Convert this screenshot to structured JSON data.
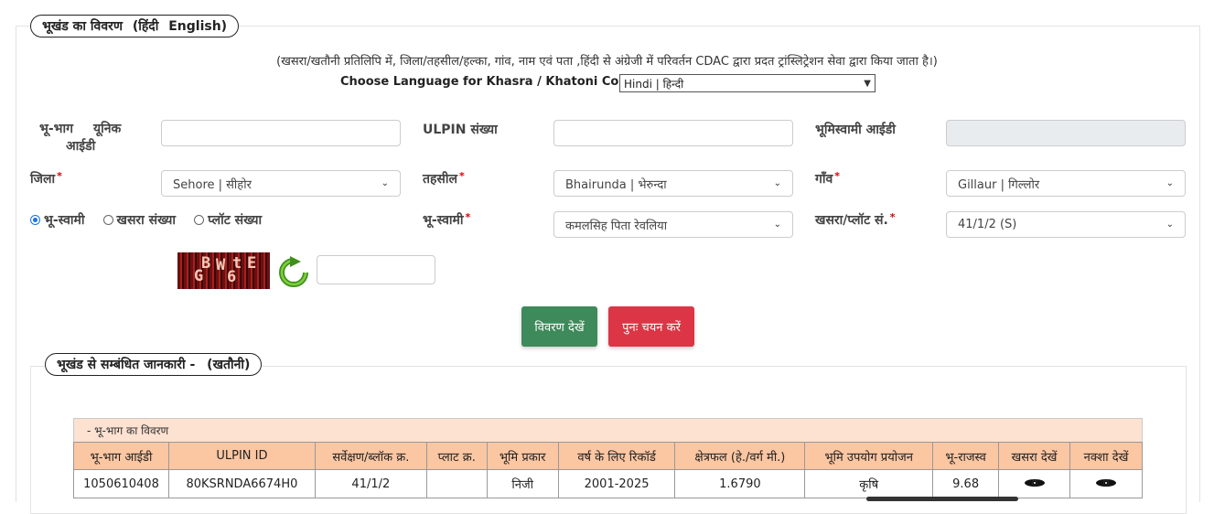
{
  "section1": {
    "title": "भूखंड का विवरण",
    "lang_hindi": "(हिंदी",
    "lang_english": "English)",
    "note": "(खसरा/खतौनी प्रतिलिपि में, जिला/तहसील/हल्का, गांव, नाम एवं पता ,हिंदी से अंग्रेजी में परिवर्तन CDAC द्वारा प्रदत ट्रांस्लिट्रेशन सेवा द्वारा किया जाता है।)",
    "choose_label": "Choose Language for Khasra / Khatoni Copy:",
    "language_value": "Hindi | हिन्दी"
  },
  "form": {
    "bhu_bhag_label_1": "भू-भाग",
    "bhu_bhag_label_2": "यूनिक",
    "bhu_bhag_label_3": "आईडी",
    "ulpin_label": "ULPIN संख्या",
    "owner_id_label": "भूमिस्वामी आईडी",
    "district_label": "जिला",
    "district_value": "Sehore | सीहोर",
    "tehsil_label": "तहसील",
    "tehsil_value": "Bhairunda | भेरुन्दा",
    "village_label": "गाँव",
    "village_value": "Gillaur | गिल्लोर",
    "radio_owner": "भू-स्वामी",
    "radio_khasra": "खसरा संख्या",
    "radio_plot": "प्लॉट संख्या",
    "owner_label": "भू-स्वामी",
    "owner_value": "कमलसिह पिता रेवलिया",
    "khasra_label": "खसरा/प्लॉट सं.",
    "khasra_value": "41/1/2 (S)",
    "required_mark": "*"
  },
  "captcha": {
    "text": "GBW6tE",
    "c1": "B",
    "c2": "W",
    "c3": "t",
    "c4": "E",
    "c5": "G",
    "c6": "6"
  },
  "buttons": {
    "view": "विवरण देखें",
    "reset": "पुनः चयन करें"
  },
  "section2": {
    "title": "भूखंड से सम्बंधित जानकारी -",
    "subtitle": "(खतौनी)",
    "table_caption": "- भू-भाग का विवरण"
  },
  "table": {
    "headers": [
      "भू-भाग आईडी",
      "ULPIN ID",
      "सर्वेक्षण/ब्लॉक क्र.",
      "प्लाट क्र.",
      "भूमि प्रकार",
      "वर्ष के लिए रिकॉर्ड",
      "क्षेत्रफल (हे./वर्ग मी.)",
      "भूमि उपयोग प्रयोजन",
      "भू-राजस्व",
      "खसरा देखें",
      "नक्शा देखें"
    ],
    "rows": [
      [
        "1050610408",
        "80KSRNDA6674H0",
        "41/1/2",
        "",
        "निजी",
        "2001-2025",
        "1.6790",
        "कृषि",
        "9.68",
        "",
        ""
      ]
    ]
  },
  "colors": {
    "green_button": "#3e8a5a",
    "red_button": "#dc3545",
    "table_header": "#fbc6a2",
    "caption_bg": "#fde1d1"
  },
  "icons": {
    "refresh": "refresh-icon",
    "eye": "eye-icon",
    "dropdown": "chevron-down-icon"
  }
}
